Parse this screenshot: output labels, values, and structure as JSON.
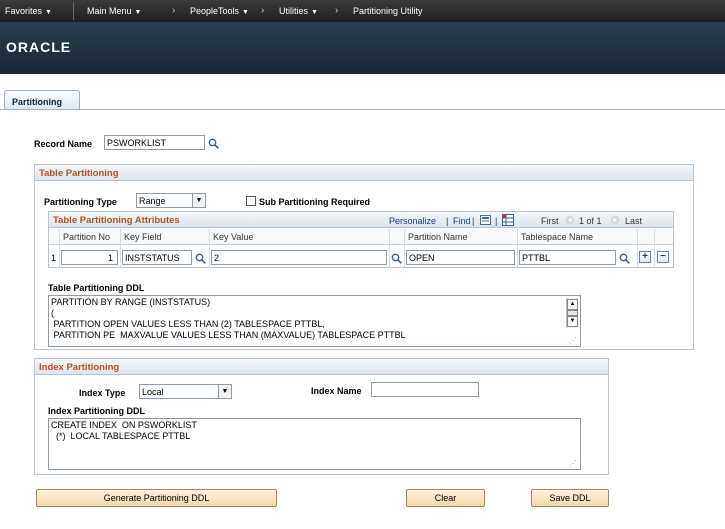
{
  "nav": {
    "favorites": "Favorites",
    "main_menu": "Main Menu",
    "peopletools": "PeopleTools",
    "utilities": "Utilities",
    "current": "Partitioning Utility"
  },
  "brand": {
    "logo": "ORACLE"
  },
  "tab": {
    "label": "Partitioning"
  },
  "record": {
    "label": "Record Name",
    "value": "PSWORKLIST"
  },
  "table_partitioning": {
    "title": "Table Partitioning",
    "type_label": "Partitioning Type",
    "type_value": "Range",
    "sub_partitioning_label": "Sub Partitioning Required",
    "sub_partitioning_checked": false,
    "attributes": {
      "title": "Table Partitioning Attributes",
      "personalize": "Personalize",
      "find": "Find",
      "first": "First",
      "range": "1 of 1",
      "last": "Last",
      "columns": [
        "Partition No",
        "Key Field",
        "Key Value",
        "Partition Name",
        "Tablespace Name"
      ],
      "rows": [
        {
          "row_num": "1",
          "partition_no": "1",
          "key_field": "INSTSTATUS",
          "key_value": "2",
          "partition_name": "OPEN",
          "tablespace_name": "PTTBL"
        }
      ]
    },
    "ddl_label": "Table Partitioning DDL",
    "ddl_text": "PARTITION BY RANGE (INSTSTATUS)\n(\n PARTITION OPEN VALUES LESS THAN (2) TABLESPACE PTTBL,\n PARTITION PE  MAXVALUE VALUES LESS THAN (MAXVALUE) TABLESPACE PTTBL"
  },
  "index_partitioning": {
    "title": "Index Partitioning",
    "type_label": "Index Type",
    "type_value": "Local",
    "name_label": "Index Name",
    "name_value": "",
    "ddl_label": "Index Partitioning DDL",
    "ddl_text": "CREATE INDEX  ON PSWORKLIST\n  (*)  LOCAL TABLESPACE PTTBL"
  },
  "buttons": {
    "generate": "Generate Partitioning DDL",
    "clear": "Clear",
    "save": "Save DDL"
  },
  "colors": {
    "nav_bg": "#2a2a2a",
    "header_bg": "#223344",
    "section_title": "#b5501e",
    "link": "#1b3c78",
    "button_bg": "#f0d9a8"
  },
  "icons": {
    "lookup": "magnifier-icon",
    "add_row": "plus-icon",
    "delete_row": "minus-icon",
    "view_all": "grid-view-icon",
    "download": "spreadsheet-icon",
    "first_arrow": "left-arrow-icon",
    "last_arrow": "right-arrow-icon"
  }
}
